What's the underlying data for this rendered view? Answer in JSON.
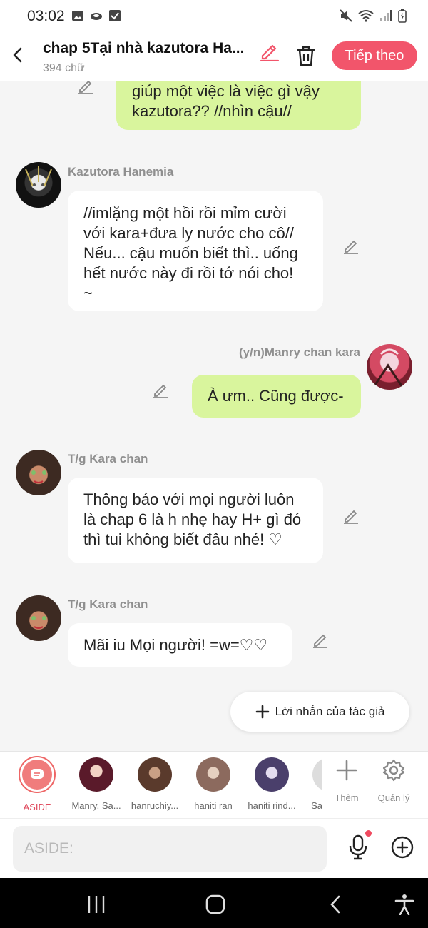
{
  "status": {
    "time": "03:02"
  },
  "header": {
    "title": "chap 5Tại nhà kazutora Ha...",
    "word_count": "394 chữ",
    "next_label": "Tiếp theo"
  },
  "messages": [
    {
      "side": "me",
      "text": "giúp một việc là việc gì vậy\nkazutora?? //nhìn cậu//"
    },
    {
      "side": "other",
      "sender": "Kazutora Hanemia",
      "text": "//imlặng một hồi rồi mỉm cười\nvới kara+đưa ly nước cho cô//\nNếu... cậu muốn biết thì.. uống\nhết nước này đi rồi tớ nói cho!\n~"
    },
    {
      "side": "me",
      "sender": "(y/n)Manry chan kara",
      "text": "À ưm.. Cũng được-"
    },
    {
      "side": "other",
      "sender": "T/g Kara chan",
      "text": "Thông báo với mọi người luôn\nlà chap 6 là h nhẹ hay H+ gì đó\nthì tui không biết đâu nhé! ♡"
    },
    {
      "side": "other",
      "sender": "T/g Kara chan",
      "text": "Mãi iu Mọi người! =w=♡♡"
    }
  ],
  "author_note_label": "Lời nhắn của tác giả",
  "characters": [
    {
      "label": "ASIDE"
    },
    {
      "label": "Manry. Sa..."
    },
    {
      "label": "hanruchiy..."
    },
    {
      "label": "haniti ran"
    },
    {
      "label": "haniti rind..."
    },
    {
      "label": "Sa"
    }
  ],
  "tools": {
    "add_label": "Thêm",
    "manage_label": "Quản lý"
  },
  "input": {
    "placeholder": "ASIDE:"
  },
  "colors": {
    "accent": "#f2556b",
    "my_bubble": "#d9f59d",
    "other_bubble": "#ffffff"
  }
}
